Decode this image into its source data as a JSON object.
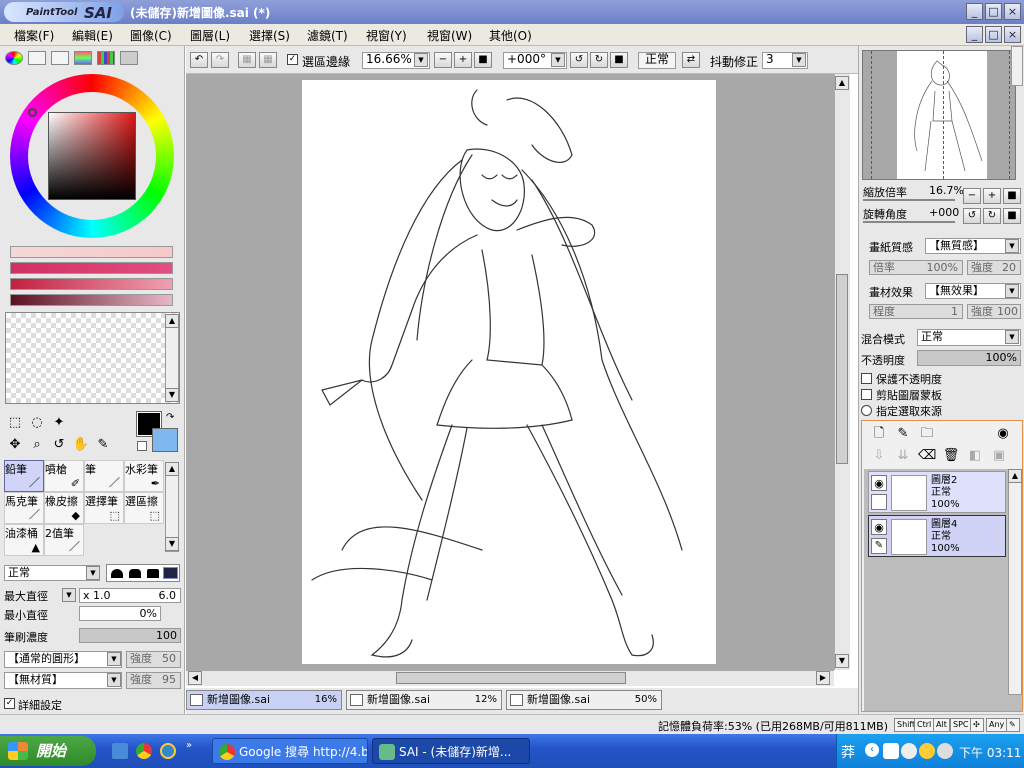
{
  "window": {
    "logo_small": "PaintTool",
    "logo_big": "SAI",
    "title": "(未儲存)新增圖像.sai (*)",
    "controls": [
      "_",
      "□",
      "×"
    ]
  },
  "menu": [
    "檔案(F)",
    "編輯(E)",
    "圖像(C)",
    "圖層(L)",
    "選擇(S)",
    "濾鏡(T)",
    "視窗(Y)",
    "視窗(W)",
    "其他(O)"
  ],
  "toolbar": {
    "select_edge_label": "選區邊緣",
    "zoom": "16.66%",
    "rotation": "+000°",
    "blend": "正常",
    "stabilizer_label": "抖動修正",
    "stabilizer_value": "3"
  },
  "brushes": {
    "row1": [
      "鉛筆",
      "噴槍",
      "筆",
      "水彩筆"
    ],
    "row2": [
      "馬克筆",
      "橡皮擦",
      "選擇筆",
      "選區擦"
    ],
    "row3": [
      "油漆桶",
      "2值筆"
    ]
  },
  "brush_settings": {
    "mode": "正常",
    "max_size_label": "最大直徑",
    "max_size_mult": "x 1.0",
    "max_size_value": "6.0",
    "min_size_label": "最小直徑",
    "min_size_value": "0%",
    "density_label": "筆刷濃度",
    "density_value": "100",
    "shape": "【通常的圓形】",
    "shape_strength_label": "強度",
    "shape_strength": "50",
    "texture": "【無材質】",
    "texture_strength_label": "強度",
    "texture_strength": "95",
    "detail_label": "詳細設定"
  },
  "navigator": {
    "zoom_label": "縮放倍率",
    "zoom_value": "16.7%",
    "angle_label": "旋轉角度",
    "angle_value": "+000"
  },
  "paper": {
    "texture_label": "畫紙質感",
    "texture_value": "【無質感】",
    "scale_label": "倍率",
    "scale_value": "100%",
    "strength_label": "強度",
    "strength_value": "20",
    "effect_label": "畫材效果",
    "effect_value": "【無效果】",
    "degree_label": "程度",
    "degree_value": "1",
    "effect_strength_label": "強度",
    "effect_strength_value": "100"
  },
  "layer_props": {
    "blend_label": "混合模式",
    "blend_value": "正常",
    "opacity_label": "不透明度",
    "opacity_value": "100%",
    "opt1": "保護不透明度",
    "opt2": "剪貼圖層蒙板",
    "opt3": "指定選取來源"
  },
  "layers": [
    {
      "name": "圖層2",
      "mode": "正常",
      "opacity": "100%"
    },
    {
      "name": "圖層4",
      "mode": "正常",
      "opacity": "100%"
    }
  ],
  "doc_tabs": [
    {
      "name": "新增圖像.sai",
      "percent": "16%"
    },
    {
      "name": "新增圖像.sai",
      "percent": "12%"
    },
    {
      "name": "新增圖像.sai",
      "percent": "50%"
    }
  ],
  "status": {
    "memory": "記憶體負荷率:53% (已用268MB/可用811MB)",
    "keys": [
      "Shift",
      "Ctrl",
      "Alt",
      "SPC",
      "Any"
    ]
  },
  "taskbar": {
    "start": "開始",
    "item1": "Google 搜尋 http://4.b...",
    "item2": "SAI - (未儲存)新增...",
    "tray_lang": "莽",
    "clock": "下午 03:11"
  },
  "colors": {
    "title_bar": "#6b7fc8",
    "active_tab": "#c8d0f4",
    "layer_bg": "#dfe0fb",
    "taskbar": "#2455c8",
    "start_green": "#3a9a35"
  }
}
